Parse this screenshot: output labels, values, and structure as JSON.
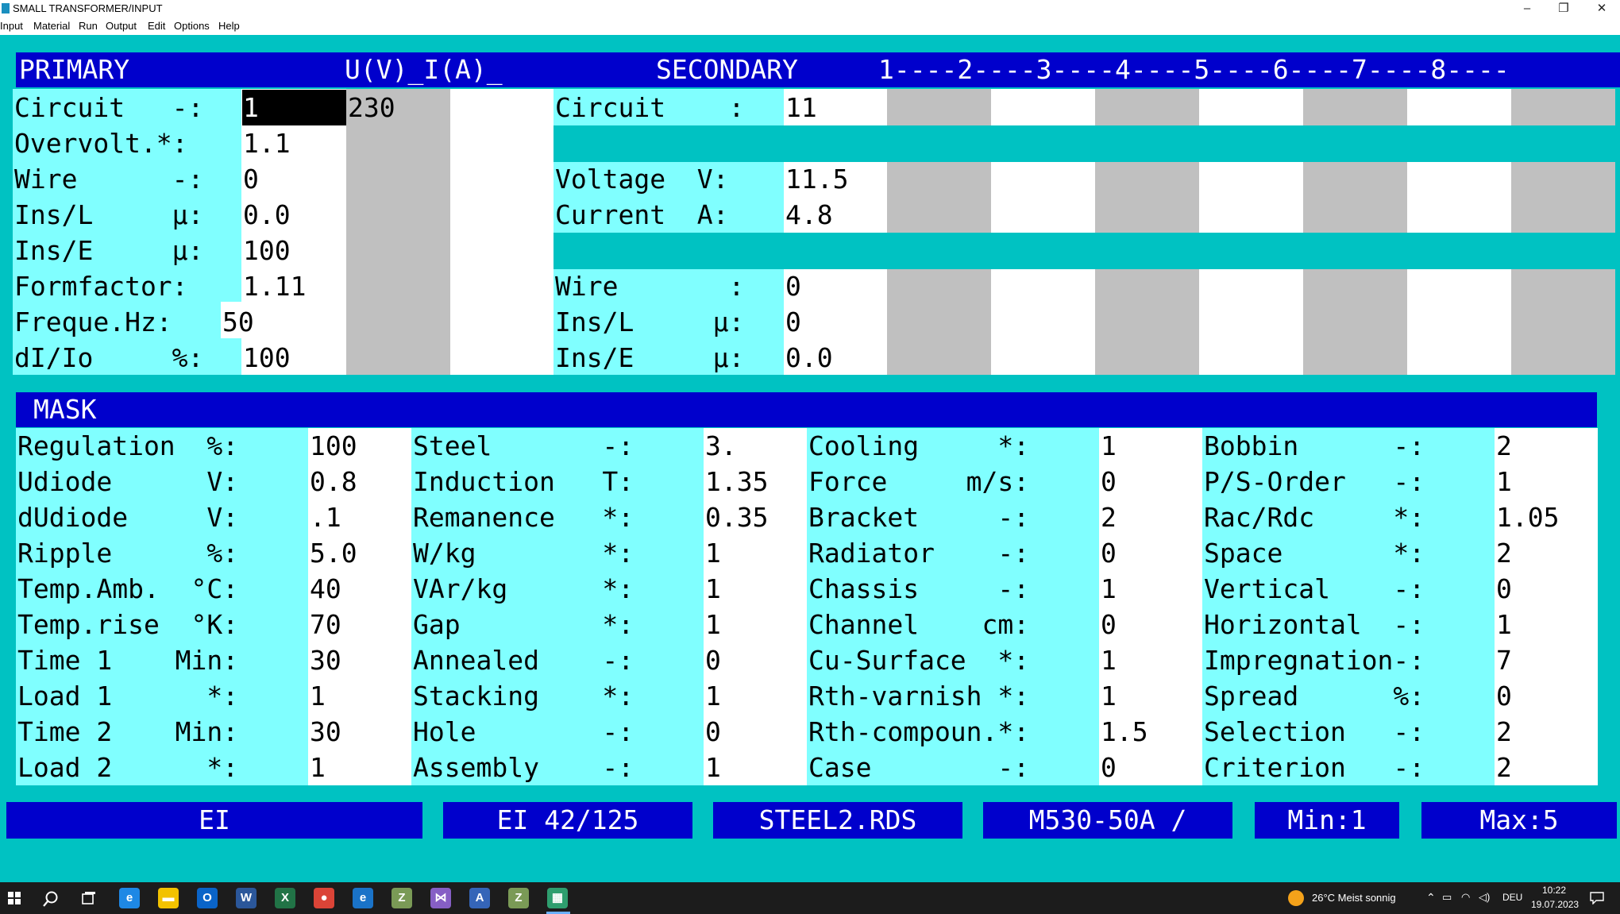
{
  "window": {
    "title": "SMALL TRANSFORMER/INPUT",
    "controls": {
      "minimize": "–",
      "restore": "❐",
      "close": "✕"
    }
  },
  "menu": [
    "Input",
    "Material",
    "Run",
    "Output",
    "Edit",
    "Options",
    "Help"
  ],
  "primary": {
    "header": "PRIMARY",
    "uv_header": "U(V)_I(A)_",
    "rows": [
      {
        "label": "Circuit   -:",
        "value": "1"
      },
      {
        "label": "Overvolt.*:",
        "value": "1.1"
      },
      {
        "label": "Wire      -:",
        "value": "0"
      },
      {
        "label": "Ins/L     µ:",
        "value": "0.0"
      },
      {
        "label": "Ins/E     µ:",
        "value": "100"
      },
      {
        "label": "Formfactor:",
        "value": "1.11"
      },
      {
        "label": "Freque.Hz:",
        "value": "50"
      },
      {
        "label": "dI/Io     %:",
        "value": "100"
      }
    ],
    "uv_value": "230"
  },
  "secondary": {
    "header": "SECONDARY",
    "columns_header": "1----2----3----4----5----6----7----8----",
    "rows": [
      {
        "label": "Circuit    :",
        "value": "11"
      },
      {
        "label": "Voltage  V:",
        "value": "11.5"
      },
      {
        "label": "Current  A:",
        "value": "4.8"
      },
      {
        "label": "Wire       :",
        "value": "0"
      },
      {
        "label": "Ins/L     µ:",
        "value": "0"
      },
      {
        "label": "Ins/E     µ:",
        "value": "0.0"
      }
    ]
  },
  "mask": {
    "header": "MASK",
    "columns": [
      [
        {
          "label": "Regulation  %:",
          "value": "100"
        },
        {
          "label": "Udiode      V:",
          "value": "0.8"
        },
        {
          "label": "dUdiode     V:",
          "value": ".1"
        },
        {
          "label": "Ripple      %:",
          "value": "5.0"
        },
        {
          "label": "Temp.Amb.  °C:",
          "value": "40"
        },
        {
          "label": "Temp.rise  °K:",
          "value": "70"
        },
        {
          "label": "Time 1    Min:",
          "value": "30"
        },
        {
          "label": "Load 1      *:",
          "value": "1"
        },
        {
          "label": "Time 2    Min:",
          "value": "30"
        },
        {
          "label": "Load 2      *:",
          "value": "1"
        }
      ],
      [
        {
          "label": "Steel       -:",
          "value": "3."
        },
        {
          "label": "Induction   T:",
          "value": "1.35"
        },
        {
          "label": "Remanence   *:",
          "value": "0.35"
        },
        {
          "label": "W/kg        *:",
          "value": "1"
        },
        {
          "label": "VAr/kg      *:",
          "value": "1"
        },
        {
          "label": "Gap         *:",
          "value": "1"
        },
        {
          "label": "Annealed    -:",
          "value": "0"
        },
        {
          "label": "Stacking    *:",
          "value": "1"
        },
        {
          "label": "Hole        -:",
          "value": "0"
        },
        {
          "label": "Assembly    -:",
          "value": "1"
        }
      ],
      [
        {
          "label": "Cooling     *:",
          "value": "1"
        },
        {
          "label": "Force     m/s:",
          "value": "0"
        },
        {
          "label": "Bracket     -:",
          "value": "2"
        },
        {
          "label": "Radiator    -:",
          "value": "0"
        },
        {
          "label": "Chassis     -:",
          "value": "1"
        },
        {
          "label": "Channel    cm:",
          "value": "0"
        },
        {
          "label": "Cu-Surface  *:",
          "value": "1"
        },
        {
          "label": "Rth-varnish *:",
          "value": "1"
        },
        {
          "label": "Rth-compoun.*:",
          "value": "1.5"
        },
        {
          "label": "Case        -:",
          "value": "0"
        }
      ],
      [
        {
          "label": "Bobbin      -:",
          "value": "2"
        },
        {
          "label": "P/S-Order   -:",
          "value": "1"
        },
        {
          "label": "Rac/Rdc     *:",
          "value": "1.05"
        },
        {
          "label": "Space       *:",
          "value": "2"
        },
        {
          "label": "Vertical    -:",
          "value": "0"
        },
        {
          "label": "Horizontal  -:",
          "value": "1"
        },
        {
          "label": "Impregnation-:",
          "value": "7"
        },
        {
          "label": "Spread      %:",
          "value": "0"
        },
        {
          "label": "Selection   -:",
          "value": "2"
        },
        {
          "label": "Criterion   -:",
          "value": "2"
        }
      ]
    ]
  },
  "status_buttons": [
    {
      "name": "core-type-button",
      "label": "EI"
    },
    {
      "name": "core-size-button",
      "label": "EI 42/125"
    },
    {
      "name": "steel-file-button",
      "label": "STEEL2.RDS"
    },
    {
      "name": "steel-grade-button",
      "label": "M530-50A /"
    },
    {
      "name": "min-button",
      "label": "Min:1"
    },
    {
      "name": "max-button",
      "label": "Max:5"
    }
  ],
  "taskbar": {
    "weather": "26°C  Meist sonnig",
    "language": "DEU",
    "time": "10:22",
    "date": "19.07.2023",
    "apps": [
      {
        "name": "edge-icon",
        "glyph": "e",
        "color": "#1e88e5"
      },
      {
        "name": "file-explorer-icon",
        "glyph": "▬",
        "color": "#f2c200"
      },
      {
        "name": "outlook-icon",
        "glyph": "O",
        "color": "#0a64c8"
      },
      {
        "name": "word-icon",
        "glyph": "W",
        "color": "#2b579a"
      },
      {
        "name": "excel-icon",
        "glyph": "X",
        "color": "#217346"
      },
      {
        "name": "chrome-icon",
        "glyph": "●",
        "color": "#db4437"
      },
      {
        "name": "internet-explorer-icon",
        "glyph": "e",
        "color": "#1a73c8"
      },
      {
        "name": "app-z-icon",
        "glyph": "Z",
        "color": "#7a9a56"
      },
      {
        "name": "visual-studio-icon",
        "glyph": "⋈",
        "color": "#865fc5"
      },
      {
        "name": "app-a-icon",
        "glyph": "A",
        "color": "#3565b8"
      },
      {
        "name": "app-z2-icon",
        "glyph": "Z",
        "color": "#7a9a56"
      },
      {
        "name": "calculator-icon",
        "glyph": "▦",
        "color": "#2e9e6e"
      }
    ]
  }
}
